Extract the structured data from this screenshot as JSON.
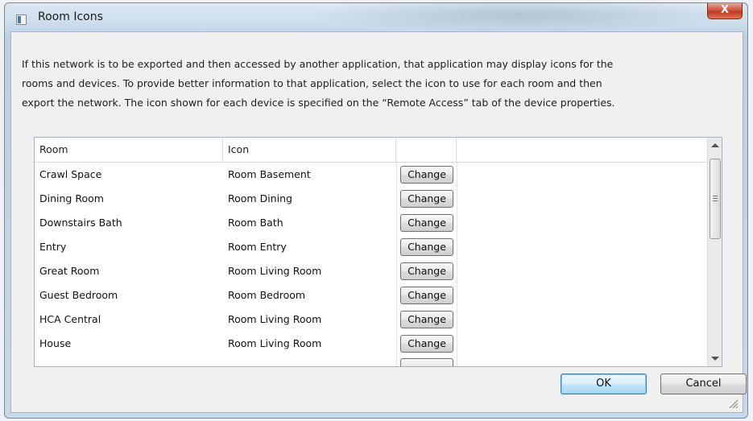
{
  "window": {
    "title": "Room Icons",
    "close_label": "X"
  },
  "description": {
    "line1": "If this network is to be exported and then accessed by another application, that application may display icons for the",
    "line2": "rooms and devices. To provide better information to that application, select the icon to use for each room and then",
    "line3": "export the network. The icon shown for each device is specified on the “Remote Access” tab of the device properties."
  },
  "grid": {
    "columns": [
      "Room",
      "Icon",
      "",
      ""
    ],
    "rows": [
      {
        "room": "Crawl Space",
        "icon": "Room Basement",
        "action": "Change"
      },
      {
        "room": "Dining Room",
        "icon": "Room Dining",
        "action": "Change"
      },
      {
        "room": "Downstairs Bath",
        "icon": "Room Bath",
        "action": "Change"
      },
      {
        "room": "Entry",
        "icon": "Room Entry",
        "action": "Change"
      },
      {
        "room": "Great Room",
        "icon": "Room Living Room",
        "action": "Change"
      },
      {
        "room": "Guest Bedroom",
        "icon": "Room Bedroom",
        "action": "Change"
      },
      {
        "room": "HCA Central",
        "icon": "Room Living Room",
        "action": "Change"
      },
      {
        "room": "House",
        "icon": "Room Living Room",
        "action": "Change"
      }
    ]
  },
  "buttons": {
    "ok": "OK",
    "cancel": "Cancel"
  }
}
